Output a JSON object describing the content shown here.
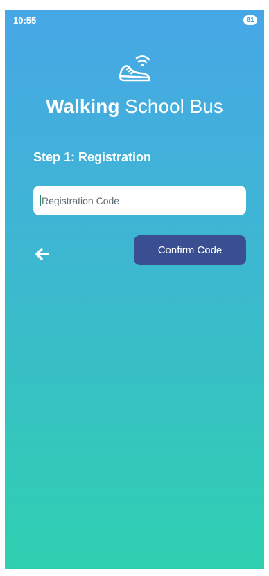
{
  "status_bar": {
    "time": "10:55",
    "battery": "81"
  },
  "app": {
    "title_bold": "Walking",
    "title_rest": " School Bus",
    "logo_icon": "sneaker-wifi-icon"
  },
  "registration": {
    "step_title": "Step 1: Registration",
    "code_input": {
      "value": "",
      "placeholder": "Registration Code"
    },
    "confirm_label": "Confirm Code",
    "back_icon": "arrow-left-icon"
  },
  "colors": {
    "gradient_top": "#47a7e6",
    "gradient_bottom": "#2fd0b0",
    "button": "#3a4f92"
  }
}
